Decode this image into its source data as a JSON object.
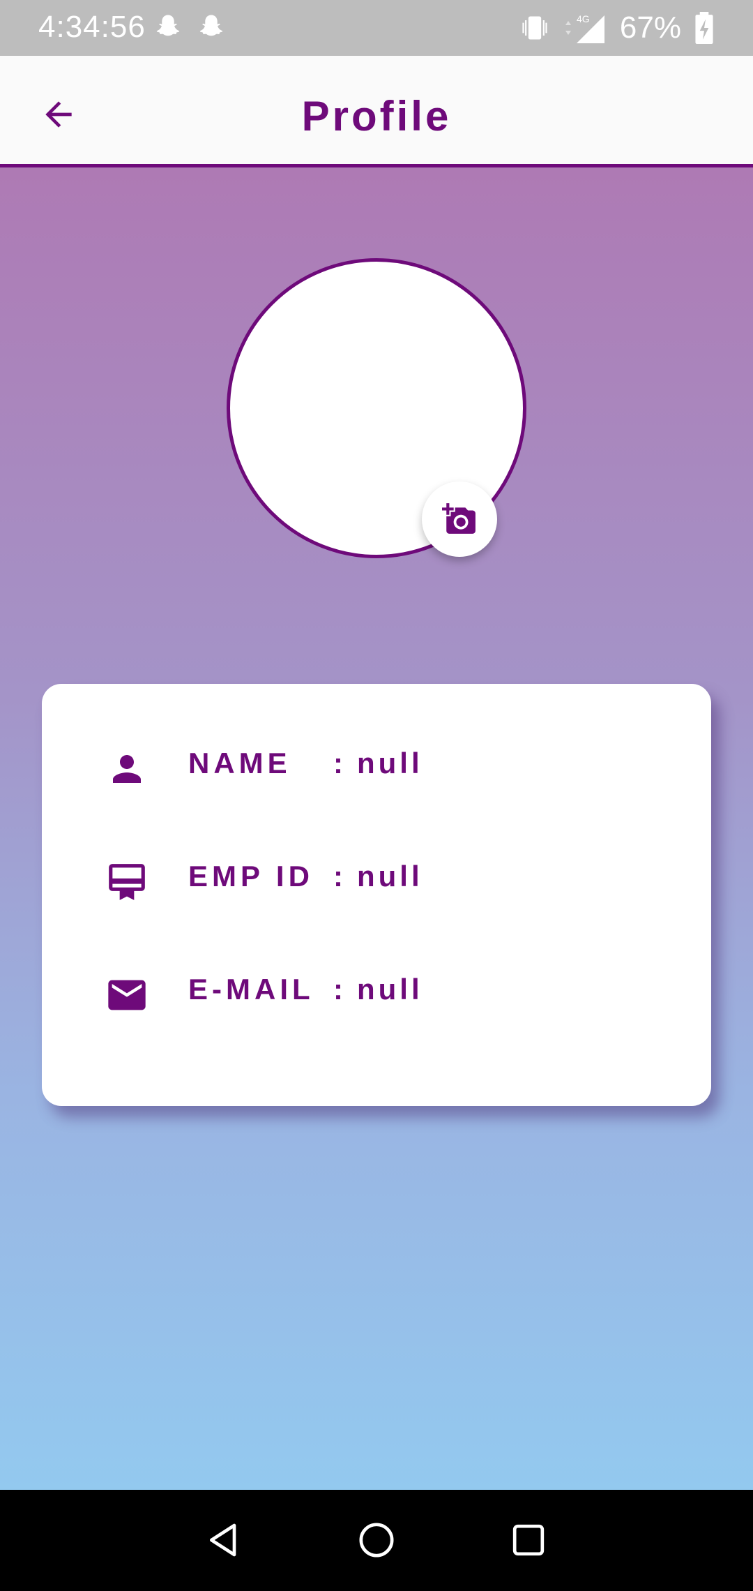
{
  "status_bar": {
    "time": "4:34:56",
    "battery_percent": "67%",
    "network_label": "4G"
  },
  "app_bar": {
    "title": "Profile",
    "back_icon": "arrow-back-icon"
  },
  "profile": {
    "avatar_icon": "avatar-placeholder",
    "camera_icon": "add-a-photo-icon"
  },
  "details": [
    {
      "icon": "person-icon",
      "label": "NAME",
      "colon": ":",
      "value": "null"
    },
    {
      "icon": "badge-card-icon",
      "label": "EMP ID",
      "colon": ":",
      "value": "null"
    },
    {
      "icon": "mail-icon",
      "label": "E-MAIL",
      "colon": ":",
      "value": "null"
    }
  ],
  "colors": {
    "accent": "#6e0a7a",
    "gradient_top": "#ae7ab4",
    "gradient_bottom": "#93c9ef"
  },
  "nav_bar": {
    "back": "nav-back-icon",
    "home": "nav-home-icon",
    "recents": "nav-recents-icon"
  }
}
